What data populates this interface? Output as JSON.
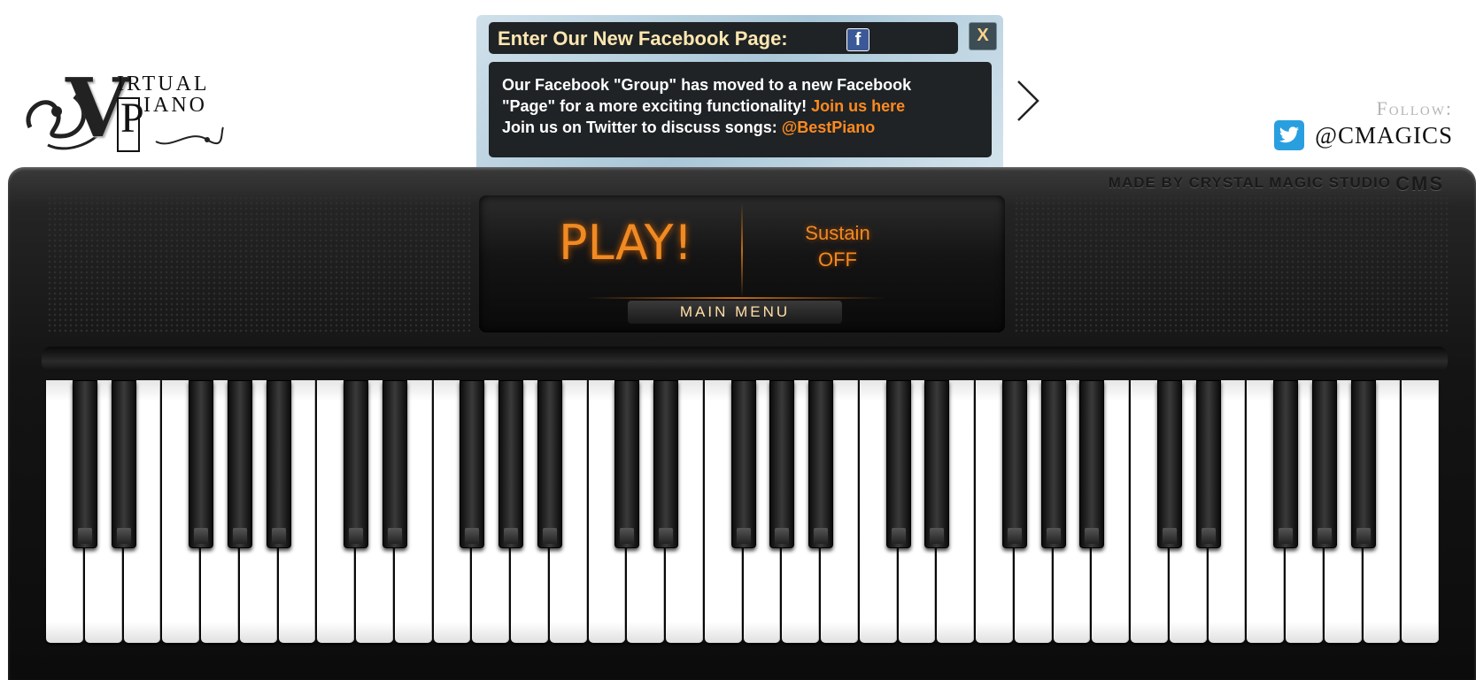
{
  "logo": {
    "letter_v": "V",
    "word_top": "IRTUAL",
    "letter_p": "P",
    "word_bottom": "IANO"
  },
  "popup": {
    "title": "Enter Our New Facebook Page:",
    "facebook_icon": "facebook-icon",
    "close_label": "X",
    "line1": "Our Facebook \"Group\" has moved to a new Facebook",
    "line2_text": "\"Page\" for a more exciting functionality!",
    "line2_link": "Join us here",
    "line3_text": "Join us on Twitter to discuss songs:",
    "line3_link": "@BestPiano"
  },
  "follow": {
    "label": "Follow:",
    "handle": "@CMAGICS",
    "icon": "twitter-icon"
  },
  "piano": {
    "brand": "MADE BY CRYSTAL MAGIC STUDIO",
    "brand_mark": "CMS",
    "play_label": "PLAY!",
    "sustain_label": "Sustain",
    "sustain_state": "OFF",
    "main_menu_label": "MAIN MENU"
  },
  "keyboard": {
    "white_key_count": 36,
    "black_key_count": 25
  },
  "colors": {
    "accent_orange": "#f08a22",
    "link_orange": "#ff8a1e",
    "panel_dark": "#1f2326",
    "twitter_blue": "#2a9fe0",
    "facebook_blue": "#3b5998"
  }
}
